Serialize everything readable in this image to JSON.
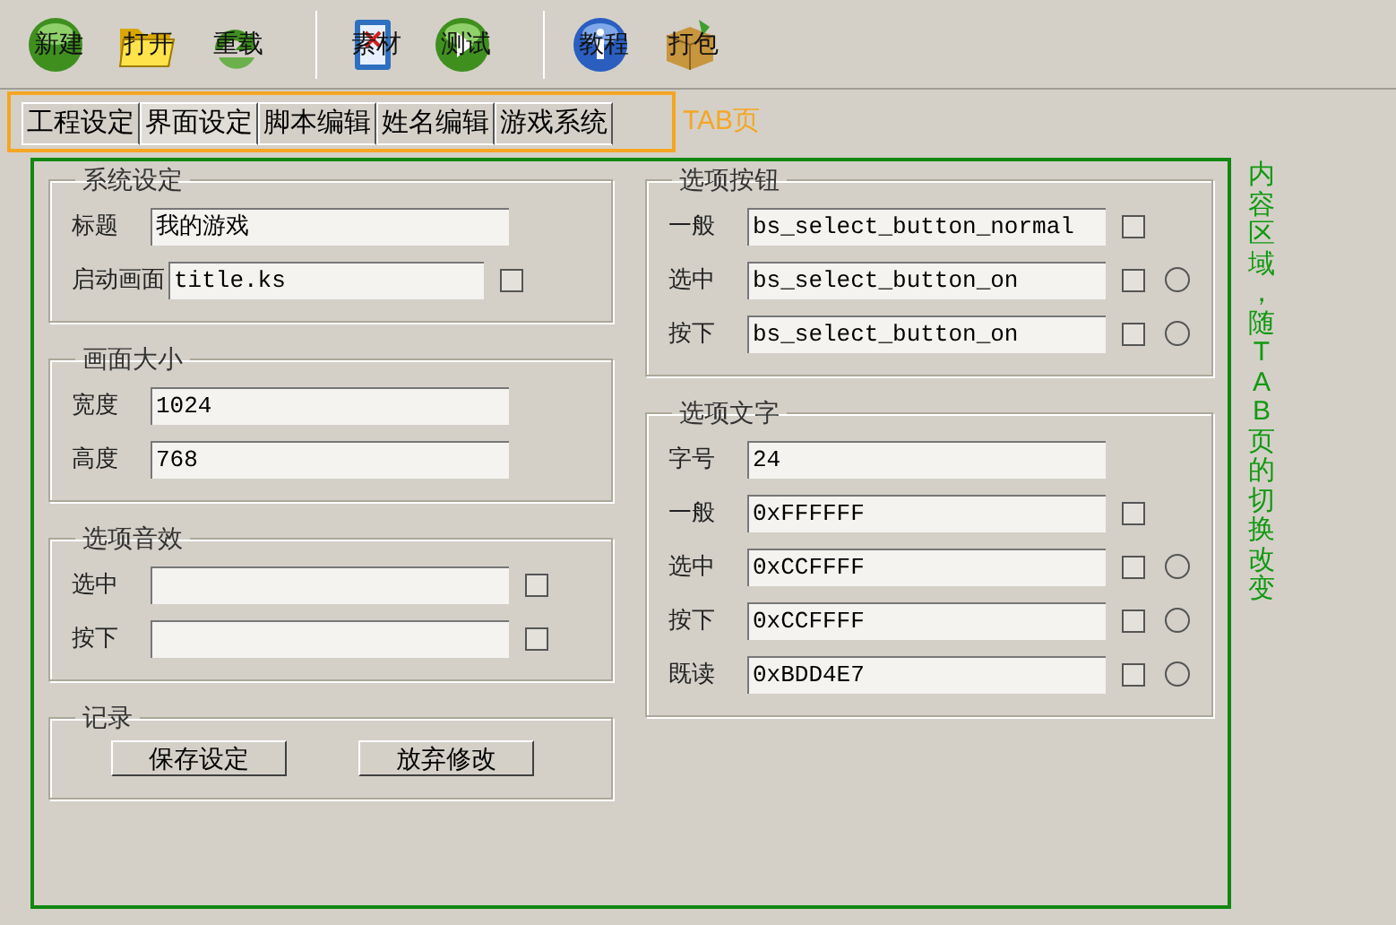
{
  "toolbar": [
    {
      "label": "新建"
    },
    {
      "label": "打开"
    },
    {
      "label": "重载"
    },
    {
      "label": "素材"
    },
    {
      "label": "测试"
    },
    {
      "label": "教程"
    },
    {
      "label": "打包"
    }
  ],
  "tabs": [
    {
      "label": "工程设定",
      "selected": false
    },
    {
      "label": "界面设定",
      "selected": true
    },
    {
      "label": "脚本编辑",
      "selected": false
    },
    {
      "label": "姓名编辑",
      "selected": false
    },
    {
      "label": "游戏系统",
      "selected": false
    }
  ],
  "tabs_note": "TAB页",
  "content_note": "内容区域，随TAB页的切换改变",
  "left_groups": [
    {
      "title": "系统设定",
      "rows": [
        {
          "label": "标题",
          "value": "我的游戏"
        },
        {
          "label": "启动画面",
          "value": "title.ks",
          "checkbox": {
            "checked": false
          }
        }
      ]
    },
    {
      "title": "画面大小",
      "rows": [
        {
          "label": "宽度",
          "value": "1024"
        },
        {
          "label": "高度",
          "value": "768"
        }
      ]
    },
    {
      "title": "选项音效",
      "rows": [
        {
          "label": "选中",
          "checkbox": {
            "checked": false
          }
        },
        {
          "label": "按下",
          "checkbox": {
            "checked": false
          }
        }
      ]
    },
    {
      "title": "记录",
      "buttons": [
        "保存设定",
        "放弃修改"
      ]
    }
  ],
  "right_groups": [
    {
      "title": "选项按钮",
      "rows": [
        {
          "label": "一般",
          "value": "bs_select_button_normal",
          "checkbox": {
            "checked": false
          }
        },
        {
          "label": "选中",
          "value": "bs_select_button_on",
          "checkbox": {
            "checked": false
          },
          "radio": {
            "selected": false
          }
        },
        {
          "label": "按下",
          "value": "bs_select_button_on",
          "checkbox": {
            "checked": false
          },
          "radio": {
            "selected": false
          }
        }
      ]
    },
    {
      "title": "选项文字",
      "rows": [
        {
          "label": "字号",
          "value": "24"
        },
        {
          "label": "一般",
          "value": "0xFFFFFF",
          "checkbox": {
            "checked": false
          }
        },
        {
          "label": "选中",
          "value": "0xCCFFFF",
          "checkbox": {
            "checked": false
          },
          "radio": {
            "selected": false
          }
        },
        {
          "label": "按下",
          "value": "0xCCFFFF",
          "checkbox": {
            "checked": false
          },
          "radio": {
            "selected": false
          }
        },
        {
          "label": "既读",
          "value": "0xBDD4E7",
          "checkbox": {
            "checked": false
          },
          "radio": {
            "selected": false
          }
        }
      ]
    }
  ]
}
